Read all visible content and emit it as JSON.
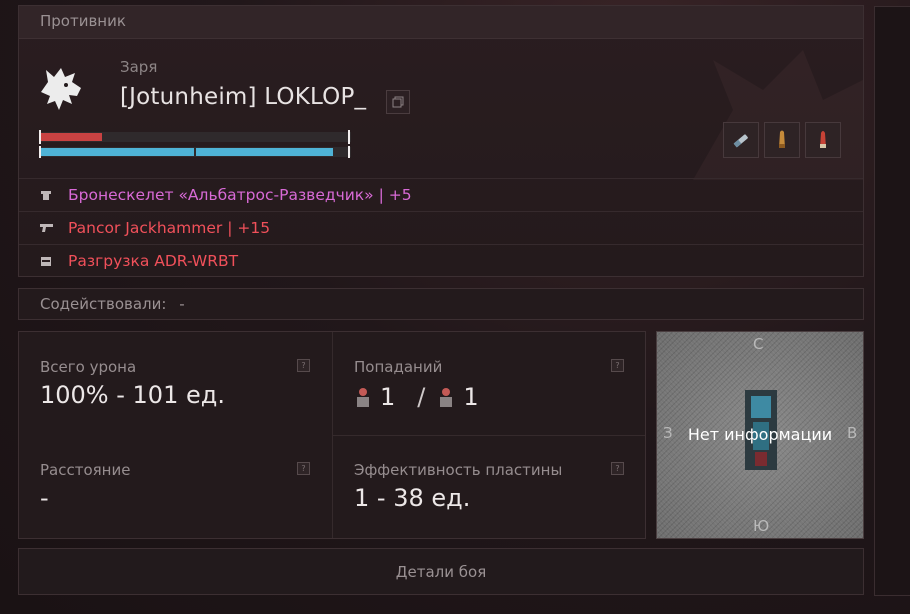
{
  "opponent": {
    "section_title": "Противник",
    "clan": "Заря",
    "player_name": "[Jotunheim] LOKLOP_",
    "health_level": 0.2,
    "armor_level": 0.95,
    "items": [
      {
        "icon": "armor-icon",
        "name": "Бронескелет «Альбатрос-Разведчик» | +5",
        "color": "#d86ad6"
      },
      {
        "icon": "gun-icon",
        "name": "Pancor Jackhammer | +15",
        "color": "#f0505a"
      },
      {
        "icon": "vest-icon",
        "name": "Разгрузка ADR-WRBT",
        "color": "#f0505a"
      }
    ],
    "consumable_icons": [
      "syringe-icon",
      "bullet-icon",
      "shell-icon"
    ]
  },
  "assisted": {
    "label": "Содействовали:",
    "value": "-"
  },
  "stats": {
    "total_damage_label": "Всего урона",
    "total_damage_value": "100% - 101 ед.",
    "hits_label": "Попаданий",
    "hits_a": "1",
    "hits_separator": "/",
    "hits_b": "1",
    "distance_label": "Расстояние",
    "distance_value": "-",
    "plate_label": "Эффективность пластины",
    "plate_value": "1 - 38 ед.",
    "help_glyph": "?"
  },
  "map": {
    "north": "С",
    "south": "Ю",
    "west": "З",
    "east": "В",
    "message": "Нет информации"
  },
  "details_button": "Детали боя"
}
